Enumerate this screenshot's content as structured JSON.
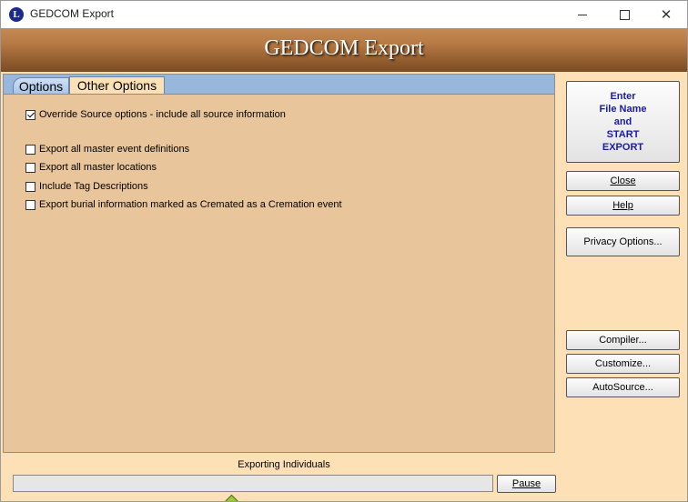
{
  "window": {
    "title": "GEDCOM Export"
  },
  "banner": {
    "title": "GEDCOM Export"
  },
  "tabs": [
    {
      "label": "Options"
    },
    {
      "label": "Other Options"
    }
  ],
  "options": [
    {
      "label": "Override Source options - include all source information",
      "checked": true
    },
    {
      "label": "Export all master event definitions",
      "checked": false
    },
    {
      "label": "Export all master locations",
      "checked": false
    },
    {
      "label": "Include Tag Descriptions",
      "checked": false
    },
    {
      "label": "Export burial information marked as Cremated as a Cremation event",
      "checked": false
    }
  ],
  "buttons": {
    "start_lines": [
      "Enter",
      "File Name",
      "and",
      "START",
      "EXPORT"
    ],
    "close": "Close",
    "help": "Help",
    "privacy": "Privacy Options...",
    "compiler": "Compiler...",
    "customize": "Customize...",
    "autosource": "AutoSource...",
    "pause": "Pause"
  },
  "status": {
    "label": "Exporting Individuals",
    "progress": 0
  },
  "colors": {
    "background": "#fde0b6",
    "panel": "#e8c59b",
    "tabstrip": "#98b7dc",
    "start_text": "#1a1aa8"
  }
}
